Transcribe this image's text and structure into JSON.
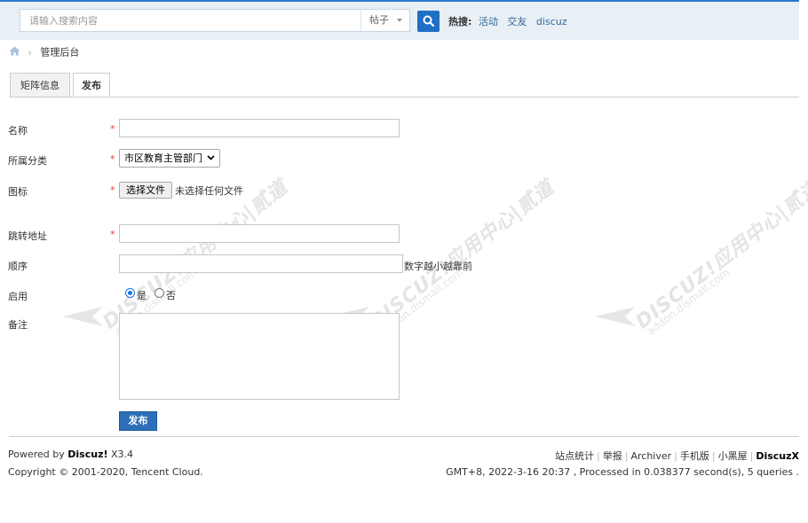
{
  "search": {
    "placeholder": "请输入搜索内容",
    "type_label": "帖子",
    "hot_label": "热搜:",
    "hot_links": [
      "活动",
      "交友",
      "discuz"
    ]
  },
  "breadcrumb": {
    "current": "管理后台"
  },
  "tabs": [
    {
      "label": "矩阵信息",
      "active": false
    },
    {
      "label": "发布",
      "active": true
    }
  ],
  "form": {
    "name_label": "名称",
    "category_label": "所属分类",
    "category_value": "市区教育主管部门",
    "icon_label": "图标",
    "file_button": "选择文件",
    "file_status": "未选择任何文件",
    "url_label": "跳转地址",
    "order_label": "顺序",
    "order_hint": "数字越小越靠前",
    "enable_label": "启用",
    "enable_yes": "是",
    "enable_no": "否",
    "enable_value": "是",
    "note_label": "备注",
    "required_mark": "*",
    "submit": "发布"
  },
  "watermark": {
    "mark": "DISCUZ!应用中心|贰道",
    "url": "addon.dismall.com"
  },
  "footer": {
    "powered_prefix": "Powered by ",
    "powered_brand": "Discuz!",
    "version": " X3.4",
    "copyright": "Copyright © 2001-2020, Tencent Cloud.",
    "links": [
      "站点统计",
      "举报",
      "Archiver",
      "手机版",
      "小黑屋"
    ],
    "brand_link": "DiscuzX",
    "stats": "GMT+8, 2022-3-16 20:37 , Processed in 0.038377 second(s), 5 queries ."
  },
  "colors": {
    "accent": "#1f6fc4",
    "required": "#e5403f",
    "link": "#336699"
  }
}
